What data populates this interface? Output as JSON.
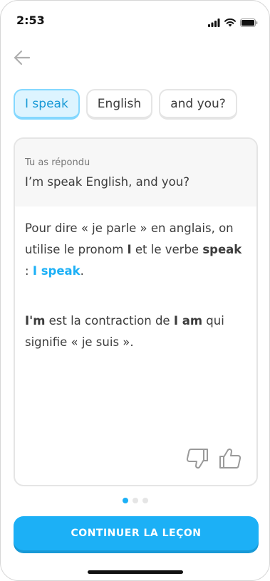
{
  "status_bar": {
    "time": "2:53"
  },
  "chips": [
    {
      "label": "I speak",
      "selected": true
    },
    {
      "label": "English",
      "selected": false
    },
    {
      "label": "and you?",
      "selected": false
    }
  ],
  "answer": {
    "label": "Tu as répondu",
    "text": "I’m speak English, and you?"
  },
  "explanation": {
    "p1_part1": "Pour dire « je parle » en anglais, on utilise le pronom ",
    "p1_bold1": "I",
    "p1_part2": " et le verbe ",
    "p1_bold2": "speak",
    "p1_part3": " : ",
    "p1_highlight": "I speak",
    "p1_part4": ".",
    "p2_bold1": "I'm",
    "p2_part1": " est la contraction de ",
    "p2_bold2": "I am",
    "p2_part2": " qui signifie « je suis »."
  },
  "pagination": {
    "current": 1,
    "total": 3
  },
  "continue_label": "CONTINUER LA LEÇON",
  "colors": {
    "accent": "#1cb0f6",
    "accent_dark": "#1899d6",
    "chip_selected_bg": "#ddf4ff"
  },
  "icons": [
    "back-arrow-icon",
    "signal-icon",
    "wifi-icon",
    "battery-icon",
    "thumbs-down-icon",
    "thumbs-up-icon"
  ]
}
